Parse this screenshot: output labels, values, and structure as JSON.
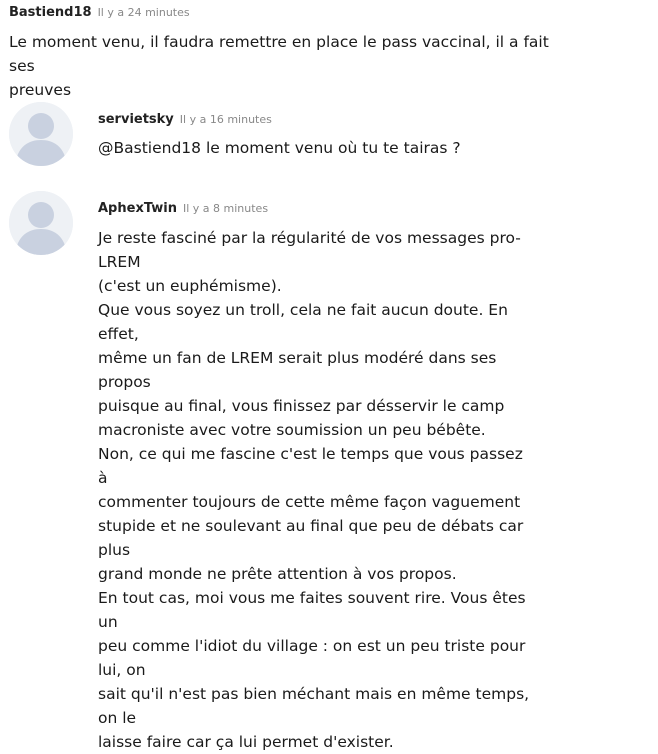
{
  "comments": [
    {
      "author": "Bastiend18",
      "time": "Il y a 24 minutes",
      "lines": [
        "Le moment venu, il faudra remettre en place le pass vaccinal, il a fait ses",
        "preuves"
      ]
    },
    {
      "author": "servietsky",
      "time": "Il y a 16 minutes",
      "avatar_icon": "default-user-icon",
      "lines": [
        "@Bastiend18 le moment venu où tu te tairas ?"
      ]
    },
    {
      "author": "AphexTwin",
      "time": "Il y a 8 minutes",
      "avatar_icon": "default-user-icon",
      "lines": [
        "Je reste fasciné par la régularité de vos messages pro-LREM",
        "(c'est un euphémisme).",
        "Que vous soyez un troll, cela ne fait aucun doute. En effet,",
        "même un fan de LREM serait plus modéré dans ses propos",
        "puisque au final, vous finissez par désservir le camp",
        "macroniste avec votre soumission un peu bébête.",
        "Non, ce qui me fascine c'est le temps que vous passez à",
        "commenter toujours de cette même façon vaguement",
        "stupide et ne soulevant au final que peu de débats car plus",
        "grand monde ne prête attention à vos propos.",
        "En tout cas, moi vous me faites souvent rire. Vous êtes un",
        "peu comme l'idiot du village : on est un peu triste pour lui, on",
        "sait qu'il n'est pas bien méchant mais en même temps, on le",
        "laisse faire car ça lui permet d'exister."
      ]
    }
  ],
  "colors": {
    "author": "#222222",
    "time": "#888888",
    "avatar_bg": "#eef1f5",
    "avatar_figure": "#c9d1e0"
  }
}
